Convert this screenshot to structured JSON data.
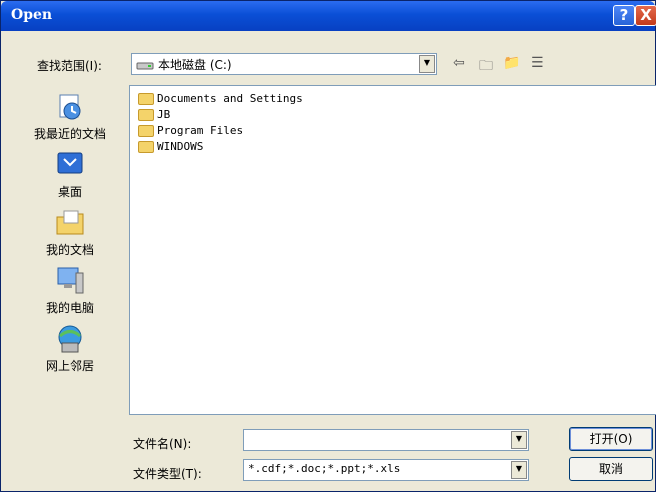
{
  "window": {
    "title": "Open",
    "help_symbol": "?",
    "close_symbol": "X"
  },
  "look_in": {
    "label": "查找范围(I):",
    "value": "本地磁盘 (C:)"
  },
  "toolbar": {
    "back": "⇦",
    "up_folder": "🗀",
    "new_folder": "📁",
    "views": "☰"
  },
  "places": [
    {
      "label": "我最近的文档",
      "icon": "recent-documents-icon"
    },
    {
      "label": "桌面",
      "icon": "desktop-icon"
    },
    {
      "label": "我的文档",
      "icon": "my-documents-icon"
    },
    {
      "label": "我的电脑",
      "icon": "my-computer-icon"
    },
    {
      "label": "网上邻居",
      "icon": "network-places-icon"
    }
  ],
  "files": [
    "Documents and Settings",
    "JB",
    "Program Files",
    "WINDOWS"
  ],
  "file_name": {
    "label": "文件名(N):",
    "value": ""
  },
  "file_type": {
    "label": "文件类型(T):",
    "value": "*.cdf;*.doc;*.ppt;*.xls"
  },
  "buttons": {
    "open": "打开(O)",
    "cancel": "取消"
  },
  "colors": {
    "titlebar": "#0a4fd6",
    "dialog_bg": "#ece9d8",
    "accent": "#003c74"
  }
}
